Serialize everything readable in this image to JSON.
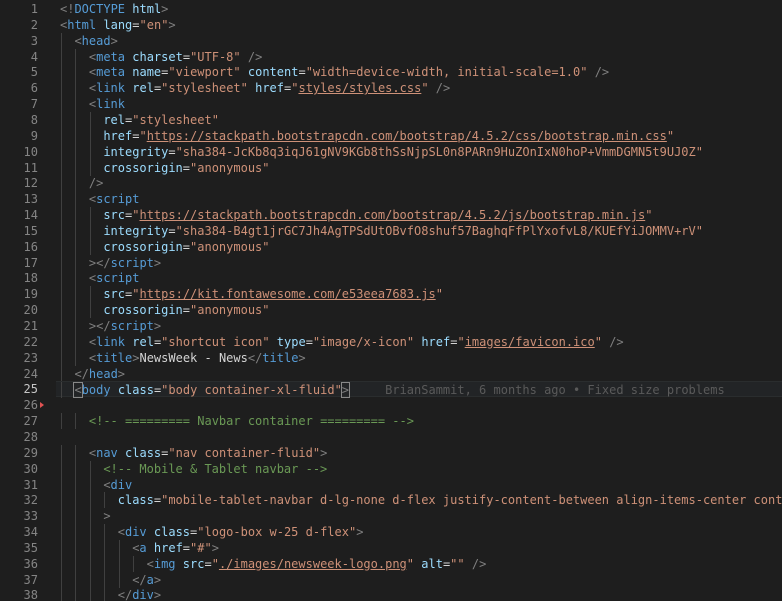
{
  "editor": {
    "current_line": 25,
    "blame": "BrianSammit, 6 months ago • Fixed size problems",
    "lines": [
      {
        "n": 1,
        "indent": 0,
        "tokens": [
          [
            "p",
            "<!"
          ],
          [
            "tag",
            "DOCTYPE"
          ],
          [
            "txt",
            " "
          ],
          [
            "attr",
            "html"
          ],
          [
            "p",
            ">"
          ]
        ]
      },
      {
        "n": 2,
        "indent": 0,
        "tokens": [
          [
            "p",
            "<"
          ],
          [
            "tag",
            "html"
          ],
          [
            "txt",
            " "
          ],
          [
            "attr",
            "lang"
          ],
          [
            "txt",
            "="
          ],
          [
            "str",
            "\"en\""
          ],
          [
            "p",
            ">"
          ]
        ]
      },
      {
        "n": 3,
        "indent": 1,
        "tokens": [
          [
            "p",
            "<"
          ],
          [
            "tag",
            "head"
          ],
          [
            "p",
            ">"
          ]
        ]
      },
      {
        "n": 4,
        "indent": 2,
        "tokens": [
          [
            "p",
            "<"
          ],
          [
            "tag",
            "meta"
          ],
          [
            "txt",
            " "
          ],
          [
            "attr",
            "charset"
          ],
          [
            "txt",
            "="
          ],
          [
            "str",
            "\"UTF-8\""
          ],
          [
            "txt",
            " "
          ],
          [
            "p",
            "/>"
          ]
        ]
      },
      {
        "n": 5,
        "indent": 2,
        "tokens": [
          [
            "p",
            "<"
          ],
          [
            "tag",
            "meta"
          ],
          [
            "txt",
            " "
          ],
          [
            "attr",
            "name"
          ],
          [
            "txt",
            "="
          ],
          [
            "str",
            "\"viewport\""
          ],
          [
            "txt",
            " "
          ],
          [
            "attr",
            "content"
          ],
          [
            "txt",
            "="
          ],
          [
            "str",
            "\"width=device-width, initial-scale=1.0\""
          ],
          [
            "txt",
            " "
          ],
          [
            "p",
            "/>"
          ]
        ]
      },
      {
        "n": 6,
        "indent": 2,
        "tokens": [
          [
            "p",
            "<"
          ],
          [
            "tag",
            "link"
          ],
          [
            "txt",
            " "
          ],
          [
            "attr",
            "rel"
          ],
          [
            "txt",
            "="
          ],
          [
            "str",
            "\"stylesheet\""
          ],
          [
            "txt",
            " "
          ],
          [
            "attr",
            "href"
          ],
          [
            "txt",
            "="
          ],
          [
            "str",
            "\""
          ],
          [
            "url",
            "styles/styles.css"
          ],
          [
            "str",
            "\""
          ],
          [
            "txt",
            " "
          ],
          [
            "p",
            "/>"
          ]
        ]
      },
      {
        "n": 7,
        "indent": 2,
        "tokens": [
          [
            "p",
            "<"
          ],
          [
            "tag",
            "link"
          ]
        ]
      },
      {
        "n": 8,
        "indent": 3,
        "tokens": [
          [
            "attr",
            "rel"
          ],
          [
            "txt",
            "="
          ],
          [
            "str",
            "\"stylesheet\""
          ]
        ]
      },
      {
        "n": 9,
        "indent": 3,
        "tokens": [
          [
            "attr",
            "href"
          ],
          [
            "txt",
            "="
          ],
          [
            "str",
            "\""
          ],
          [
            "url",
            "https://stackpath.bootstrapcdn.com/bootstrap/4.5.2/css/bootstrap.min.css"
          ],
          [
            "str",
            "\""
          ]
        ]
      },
      {
        "n": 10,
        "indent": 3,
        "tokens": [
          [
            "attr",
            "integrity"
          ],
          [
            "txt",
            "="
          ],
          [
            "str",
            "\"sha384-JcKb8q3iqJ61gNV9KGb8thSsNjpSL0n8PARn9HuZOnIxN0hoP+VmmDGMN5t9UJ0Z\""
          ]
        ]
      },
      {
        "n": 11,
        "indent": 3,
        "tokens": [
          [
            "attr",
            "crossorigin"
          ],
          [
            "txt",
            "="
          ],
          [
            "str",
            "\"anonymous\""
          ]
        ]
      },
      {
        "n": 12,
        "indent": 2,
        "tokens": [
          [
            "p",
            "/>"
          ]
        ]
      },
      {
        "n": 13,
        "indent": 2,
        "tokens": [
          [
            "p",
            "<"
          ],
          [
            "tag",
            "script"
          ]
        ]
      },
      {
        "n": 14,
        "indent": 3,
        "tokens": [
          [
            "attr",
            "src"
          ],
          [
            "txt",
            "="
          ],
          [
            "str",
            "\""
          ],
          [
            "url",
            "https://stackpath.bootstrapcdn.com/bootstrap/4.5.2/js/bootstrap.min.js"
          ],
          [
            "str",
            "\""
          ]
        ]
      },
      {
        "n": 15,
        "indent": 3,
        "tokens": [
          [
            "attr",
            "integrity"
          ],
          [
            "txt",
            "="
          ],
          [
            "str",
            "\"sha384-B4gt1jrGC7Jh4AgTPSdUtOBvfO8shuf57BaghqFfPlYxofvL8/KUEfYiJOMMV+rV\""
          ]
        ]
      },
      {
        "n": 16,
        "indent": 3,
        "tokens": [
          [
            "attr",
            "crossorigin"
          ],
          [
            "txt",
            "="
          ],
          [
            "str",
            "\"anonymous\""
          ]
        ]
      },
      {
        "n": 17,
        "indent": 2,
        "tokens": [
          [
            "p",
            "></"
          ],
          [
            "tag",
            "script"
          ],
          [
            "p",
            ">"
          ]
        ]
      },
      {
        "n": 18,
        "indent": 2,
        "tokens": [
          [
            "p",
            "<"
          ],
          [
            "tag",
            "script"
          ]
        ]
      },
      {
        "n": 19,
        "indent": 3,
        "tokens": [
          [
            "attr",
            "src"
          ],
          [
            "txt",
            "="
          ],
          [
            "str",
            "\""
          ],
          [
            "url",
            "https://kit.fontawesome.com/e53eea7683.js"
          ],
          [
            "str",
            "\""
          ]
        ]
      },
      {
        "n": 20,
        "indent": 3,
        "tokens": [
          [
            "attr",
            "crossorigin"
          ],
          [
            "txt",
            "="
          ],
          [
            "str",
            "\"anonymous\""
          ]
        ]
      },
      {
        "n": 21,
        "indent": 2,
        "tokens": [
          [
            "p",
            "></"
          ],
          [
            "tag",
            "script"
          ],
          [
            "p",
            ">"
          ]
        ]
      },
      {
        "n": 22,
        "indent": 2,
        "tokens": [
          [
            "p",
            "<"
          ],
          [
            "tag",
            "link"
          ],
          [
            "txt",
            " "
          ],
          [
            "attr",
            "rel"
          ],
          [
            "txt",
            "="
          ],
          [
            "str",
            "\"shortcut icon\""
          ],
          [
            "txt",
            " "
          ],
          [
            "attr",
            "type"
          ],
          [
            "txt",
            "="
          ],
          [
            "str",
            "\"image/x-icon\""
          ],
          [
            "txt",
            " "
          ],
          [
            "attr",
            "href"
          ],
          [
            "txt",
            "="
          ],
          [
            "str",
            "\""
          ],
          [
            "url",
            "images/favicon.ico"
          ],
          [
            "str",
            "\""
          ],
          [
            "txt",
            " "
          ],
          [
            "p",
            "/>"
          ]
        ]
      },
      {
        "n": 23,
        "indent": 2,
        "tokens": [
          [
            "p",
            "<"
          ],
          [
            "tag",
            "title"
          ],
          [
            "p",
            ">"
          ],
          [
            "txt",
            "NewsWeek - News"
          ],
          [
            "p",
            "</"
          ],
          [
            "tag",
            "title"
          ],
          [
            "p",
            ">"
          ]
        ]
      },
      {
        "n": 24,
        "indent": 1,
        "tokens": [
          [
            "p",
            "</"
          ],
          [
            "tag",
            "head"
          ],
          [
            "p",
            ">"
          ]
        ]
      },
      {
        "n": 25,
        "indent": 1,
        "tokens": [
          [
            "p",
            "<"
          ],
          [
            "tag",
            "body"
          ],
          [
            "txt",
            " "
          ],
          [
            "attr",
            "class"
          ],
          [
            "txt",
            "="
          ],
          [
            "str",
            "\"body container-xl-fluid\""
          ],
          [
            "p",
            ">"
          ]
        ]
      },
      {
        "n": 26,
        "indent": 0,
        "tokens": []
      },
      {
        "n": 27,
        "indent": 2,
        "tokens": [
          [
            "com",
            "<!-- ========= Navbar container ========= -->"
          ]
        ]
      },
      {
        "n": 28,
        "indent": 0,
        "tokens": []
      },
      {
        "n": 29,
        "indent": 2,
        "tokens": [
          [
            "p",
            "<"
          ],
          [
            "tag",
            "nav"
          ],
          [
            "txt",
            " "
          ],
          [
            "attr",
            "class"
          ],
          [
            "txt",
            "="
          ],
          [
            "str",
            "\"nav container-fluid\""
          ],
          [
            "p",
            ">"
          ]
        ]
      },
      {
        "n": 30,
        "indent": 3,
        "tokens": [
          [
            "com",
            "<!-- Mobile & Tablet navbar -->"
          ]
        ]
      },
      {
        "n": 31,
        "indent": 3,
        "tokens": [
          [
            "p",
            "<"
          ],
          [
            "tag",
            "div"
          ]
        ]
      },
      {
        "n": 32,
        "indent": 4,
        "tokens": [
          [
            "attr",
            "class"
          ],
          [
            "txt",
            "="
          ],
          [
            "str",
            "\"mobile-tablet-navbar d-lg-none d-flex justify-content-between align-items-center container\""
          ]
        ]
      },
      {
        "n": 33,
        "indent": 3,
        "tokens": [
          [
            "p",
            ">"
          ]
        ]
      },
      {
        "n": 34,
        "indent": 4,
        "tokens": [
          [
            "p",
            "<"
          ],
          [
            "tag",
            "div"
          ],
          [
            "txt",
            " "
          ],
          [
            "attr",
            "class"
          ],
          [
            "txt",
            "="
          ],
          [
            "str",
            "\"logo-box w-25 d-flex\""
          ],
          [
            "p",
            ">"
          ]
        ]
      },
      {
        "n": 35,
        "indent": 5,
        "tokens": [
          [
            "p",
            "<"
          ],
          [
            "tag",
            "a"
          ],
          [
            "txt",
            " "
          ],
          [
            "attr",
            "href"
          ],
          [
            "txt",
            "="
          ],
          [
            "str",
            "\"#\""
          ],
          [
            "p",
            ">"
          ]
        ]
      },
      {
        "n": 36,
        "indent": 6,
        "tokens": [
          [
            "p",
            "<"
          ],
          [
            "tag",
            "img"
          ],
          [
            "txt",
            " "
          ],
          [
            "attr",
            "src"
          ],
          [
            "txt",
            "="
          ],
          [
            "str",
            "\""
          ],
          [
            "url",
            "./images/newsweek-logo.png"
          ],
          [
            "str",
            "\""
          ],
          [
            "txt",
            " "
          ],
          [
            "attr",
            "alt"
          ],
          [
            "txt",
            "="
          ],
          [
            "str",
            "\"\""
          ],
          [
            "txt",
            " "
          ],
          [
            "p",
            "/>"
          ]
        ]
      },
      {
        "n": 37,
        "indent": 5,
        "tokens": [
          [
            "p",
            "</"
          ],
          [
            "tag",
            "a"
          ],
          [
            "p",
            ">"
          ]
        ]
      },
      {
        "n": 38,
        "indent": 4,
        "tokens": [
          [
            "p",
            "</"
          ],
          [
            "tag",
            "div"
          ],
          [
            "p",
            ">"
          ]
        ]
      }
    ]
  }
}
